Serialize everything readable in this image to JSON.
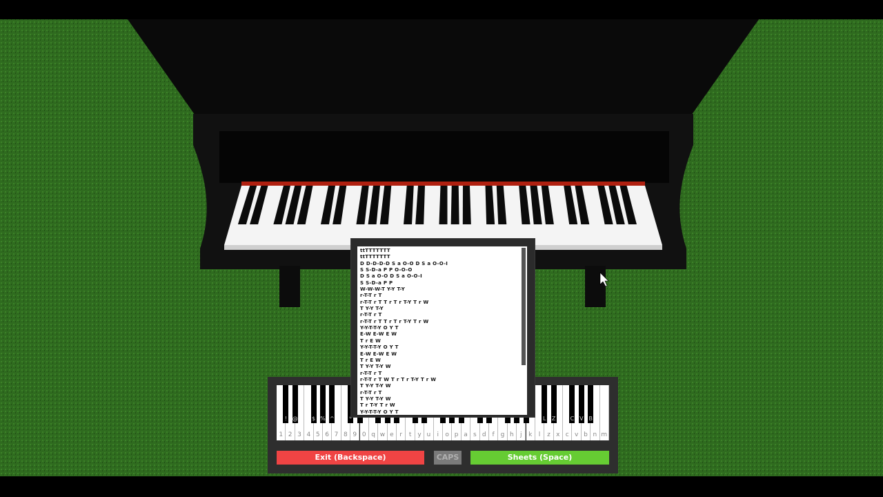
{
  "colors": {
    "grass": "#2f6b1f",
    "piano": "#0d0d0d",
    "felt": "#b02010",
    "exit": "#f04444",
    "caps": "#7a7a7a",
    "sheets": "#66cc33"
  },
  "sheet": {
    "lines": [
      "ttTTTTTTT",
      "ttTTTTTTT",
      "D D-D-D-D S a O-O D S a O-O-I",
      "S S-D-a P P O-O-O",
      "D S a O-O D S a O-O-I",
      "S S-D-a P P",
      "W-W-W-T Y-Y T-Y",
      "r-T-T r T",
      "r-T-T r T T r T r T-Y T r W",
      "T Y-Y T-Y",
      "r-T-T r T",
      "r-T-T r T T r T r T-Y T r W",
      "Y-Y-T-T-Y O Y T",
      "E-W E-W E W",
      "T r E W",
      "Y-Y-T-T-Y O Y T",
      "E-W E-W E W",
      "T r E W",
      "T Y-Y T-Y W",
      "r-T-T r T",
      "r-T-T r T W T r T r T-Y T r W",
      "T Y-Y T-Y W",
      "r-T-T r T",
      "T Y-Y T-Y W",
      "T r T-Y T r W",
      "Y-Y-T-T-Y O Y T"
    ]
  },
  "keyboard": {
    "white_keys": [
      "1",
      "2",
      "3",
      "4",
      "5",
      "6",
      "7",
      "8",
      "9",
      "0",
      "q",
      "w",
      "e",
      "r",
      "t",
      "y",
      "u",
      "i",
      "o",
      "p",
      "a",
      "s",
      "d",
      "f",
      "g",
      "h",
      "j",
      "k",
      "l",
      "z",
      "x",
      "c",
      "v",
      "b",
      "n",
      "m"
    ],
    "black_keys": [
      "!",
      "@",
      "$",
      "%",
      "^",
      "*",
      "",
      "",
      "",
      "",
      "",
      "",
      "",
      "",
      "",
      "",
      "",
      "",
      "",
      "",
      "L",
      "Z",
      "C",
      "V",
      "B"
    ]
  },
  "buttons": {
    "exit": "Exit (Backspace)",
    "caps": "CAPS",
    "sheets": "Sheets (Space)"
  }
}
